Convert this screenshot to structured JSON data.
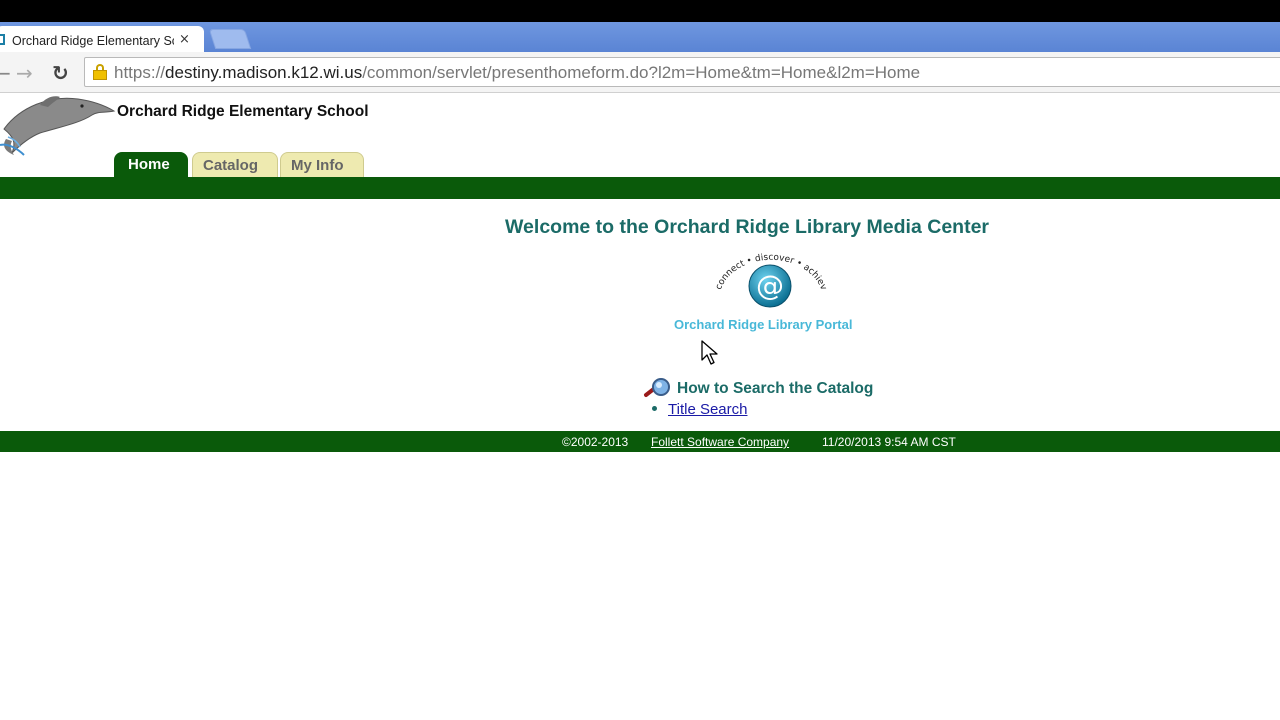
{
  "browser": {
    "tab_title": "Orchard Ridge Elementary Sc",
    "tab_close": "×",
    "url_prefix": "https://",
    "url_host": "destiny.madison.k12.wi.us",
    "url_path": "/common/servlet/presenthomeform.do?l2m=Home&tm=Home&l2m=Home",
    "back_glyph": "←",
    "forward_glyph": "→",
    "reload_glyph": "↻"
  },
  "header": {
    "school_name": "Orchard Ridge Elementary School",
    "tabs": [
      {
        "label": "Home",
        "active": true
      },
      {
        "label": "Catalog",
        "active": false
      },
      {
        "label": "My Info",
        "active": false
      }
    ]
  },
  "main": {
    "welcome": "Welcome to the Orchard Ridge Library Media Center",
    "portal_logo_text": "connect • discover • achieve",
    "portal_link": "Orchard Ridge Library Portal",
    "how_to_heading": "How to Search the Catalog",
    "links": [
      "Title Search"
    ]
  },
  "footer": {
    "copyright": "©2002-2013",
    "company": "Follett Software Company",
    "timestamp": "11/20/2013 9:54 AM CST"
  },
  "colors": {
    "green_bar": "#0a5a0a",
    "heading_teal": "#1b6b67",
    "portal_blue": "#48b8d8",
    "link_blue": "#1a1aa6"
  },
  "icons": [
    "dolphin-logo",
    "lock-icon",
    "search-magnifier-icon",
    "mouse-cursor"
  ]
}
